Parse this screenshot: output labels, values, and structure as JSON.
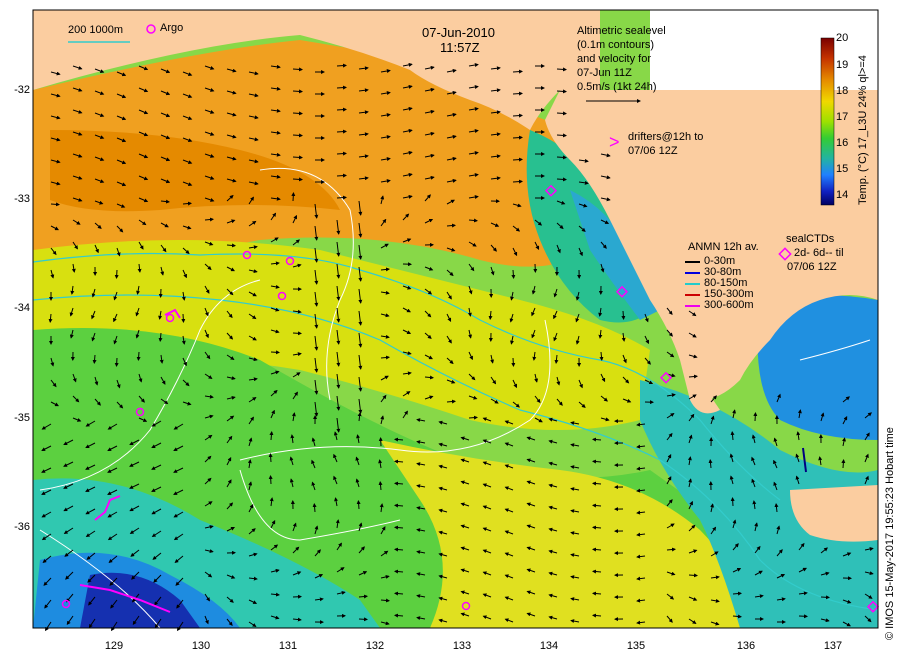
{
  "header": {
    "date": "07-Jun-2010",
    "time": "11:57Z"
  },
  "bathy_legend": {
    "label": "200  1000m",
    "argo_label": "Argo"
  },
  "altimetry_note": {
    "line1": "Altimetric sealevel",
    "line2": "(0.1m contours)",
    "line3": "and velocity for",
    "line4": "07-Jun 11Z",
    "line5": "0.5m/s (1kt 24h)"
  },
  "drifters_note": {
    "symbol": ">",
    "line1": "drifters@12h to",
    "line2": "07/06 12Z"
  },
  "anmn_legend": {
    "title": "ANMN 12h av.",
    "rows": [
      {
        "label": "0-30m",
        "color": "#000000"
      },
      {
        "label": "30-80m",
        "color": "#0000dd"
      },
      {
        "label": "80-150m",
        "color": "#22cccc"
      },
      {
        "label": "150-300m",
        "color": "#cc0000"
      },
      {
        "label": "300-600m",
        "color": "#ee00ee"
      }
    ]
  },
  "sealctd_legend": {
    "title": "sealCTDs",
    "line1": "2d- 6d-- til",
    "line2": "07/06 12Z"
  },
  "colorbar": {
    "label": "Temp. (°C) 17_L3U 24% ql>=4",
    "ticks": [
      "20",
      "19",
      "18",
      "17",
      "16",
      "15",
      "14"
    ],
    "min": 13.5,
    "max": 20,
    "stops": [
      "#7a0000",
      "#c43200",
      "#e58a00",
      "#f0d800",
      "#9ee000",
      "#33cc33",
      "#22b4a0",
      "#2080ff",
      "#1020c0",
      "#000060"
    ]
  },
  "axes": {
    "y_ticks": [
      "-32",
      "-33",
      "-34",
      "-35",
      "-36"
    ],
    "x_ticks": [
      "129",
      "130",
      "131",
      "132",
      "133",
      "134",
      "135",
      "136",
      "137"
    ]
  },
  "credit": "© IMOS 15-May-2017 19:55:23 Hobart time",
  "colors": {
    "land": "#fbcda0",
    "contour": "#ffffff",
    "bathy": "#33cccc",
    "argo": "#ff00ff"
  }
}
